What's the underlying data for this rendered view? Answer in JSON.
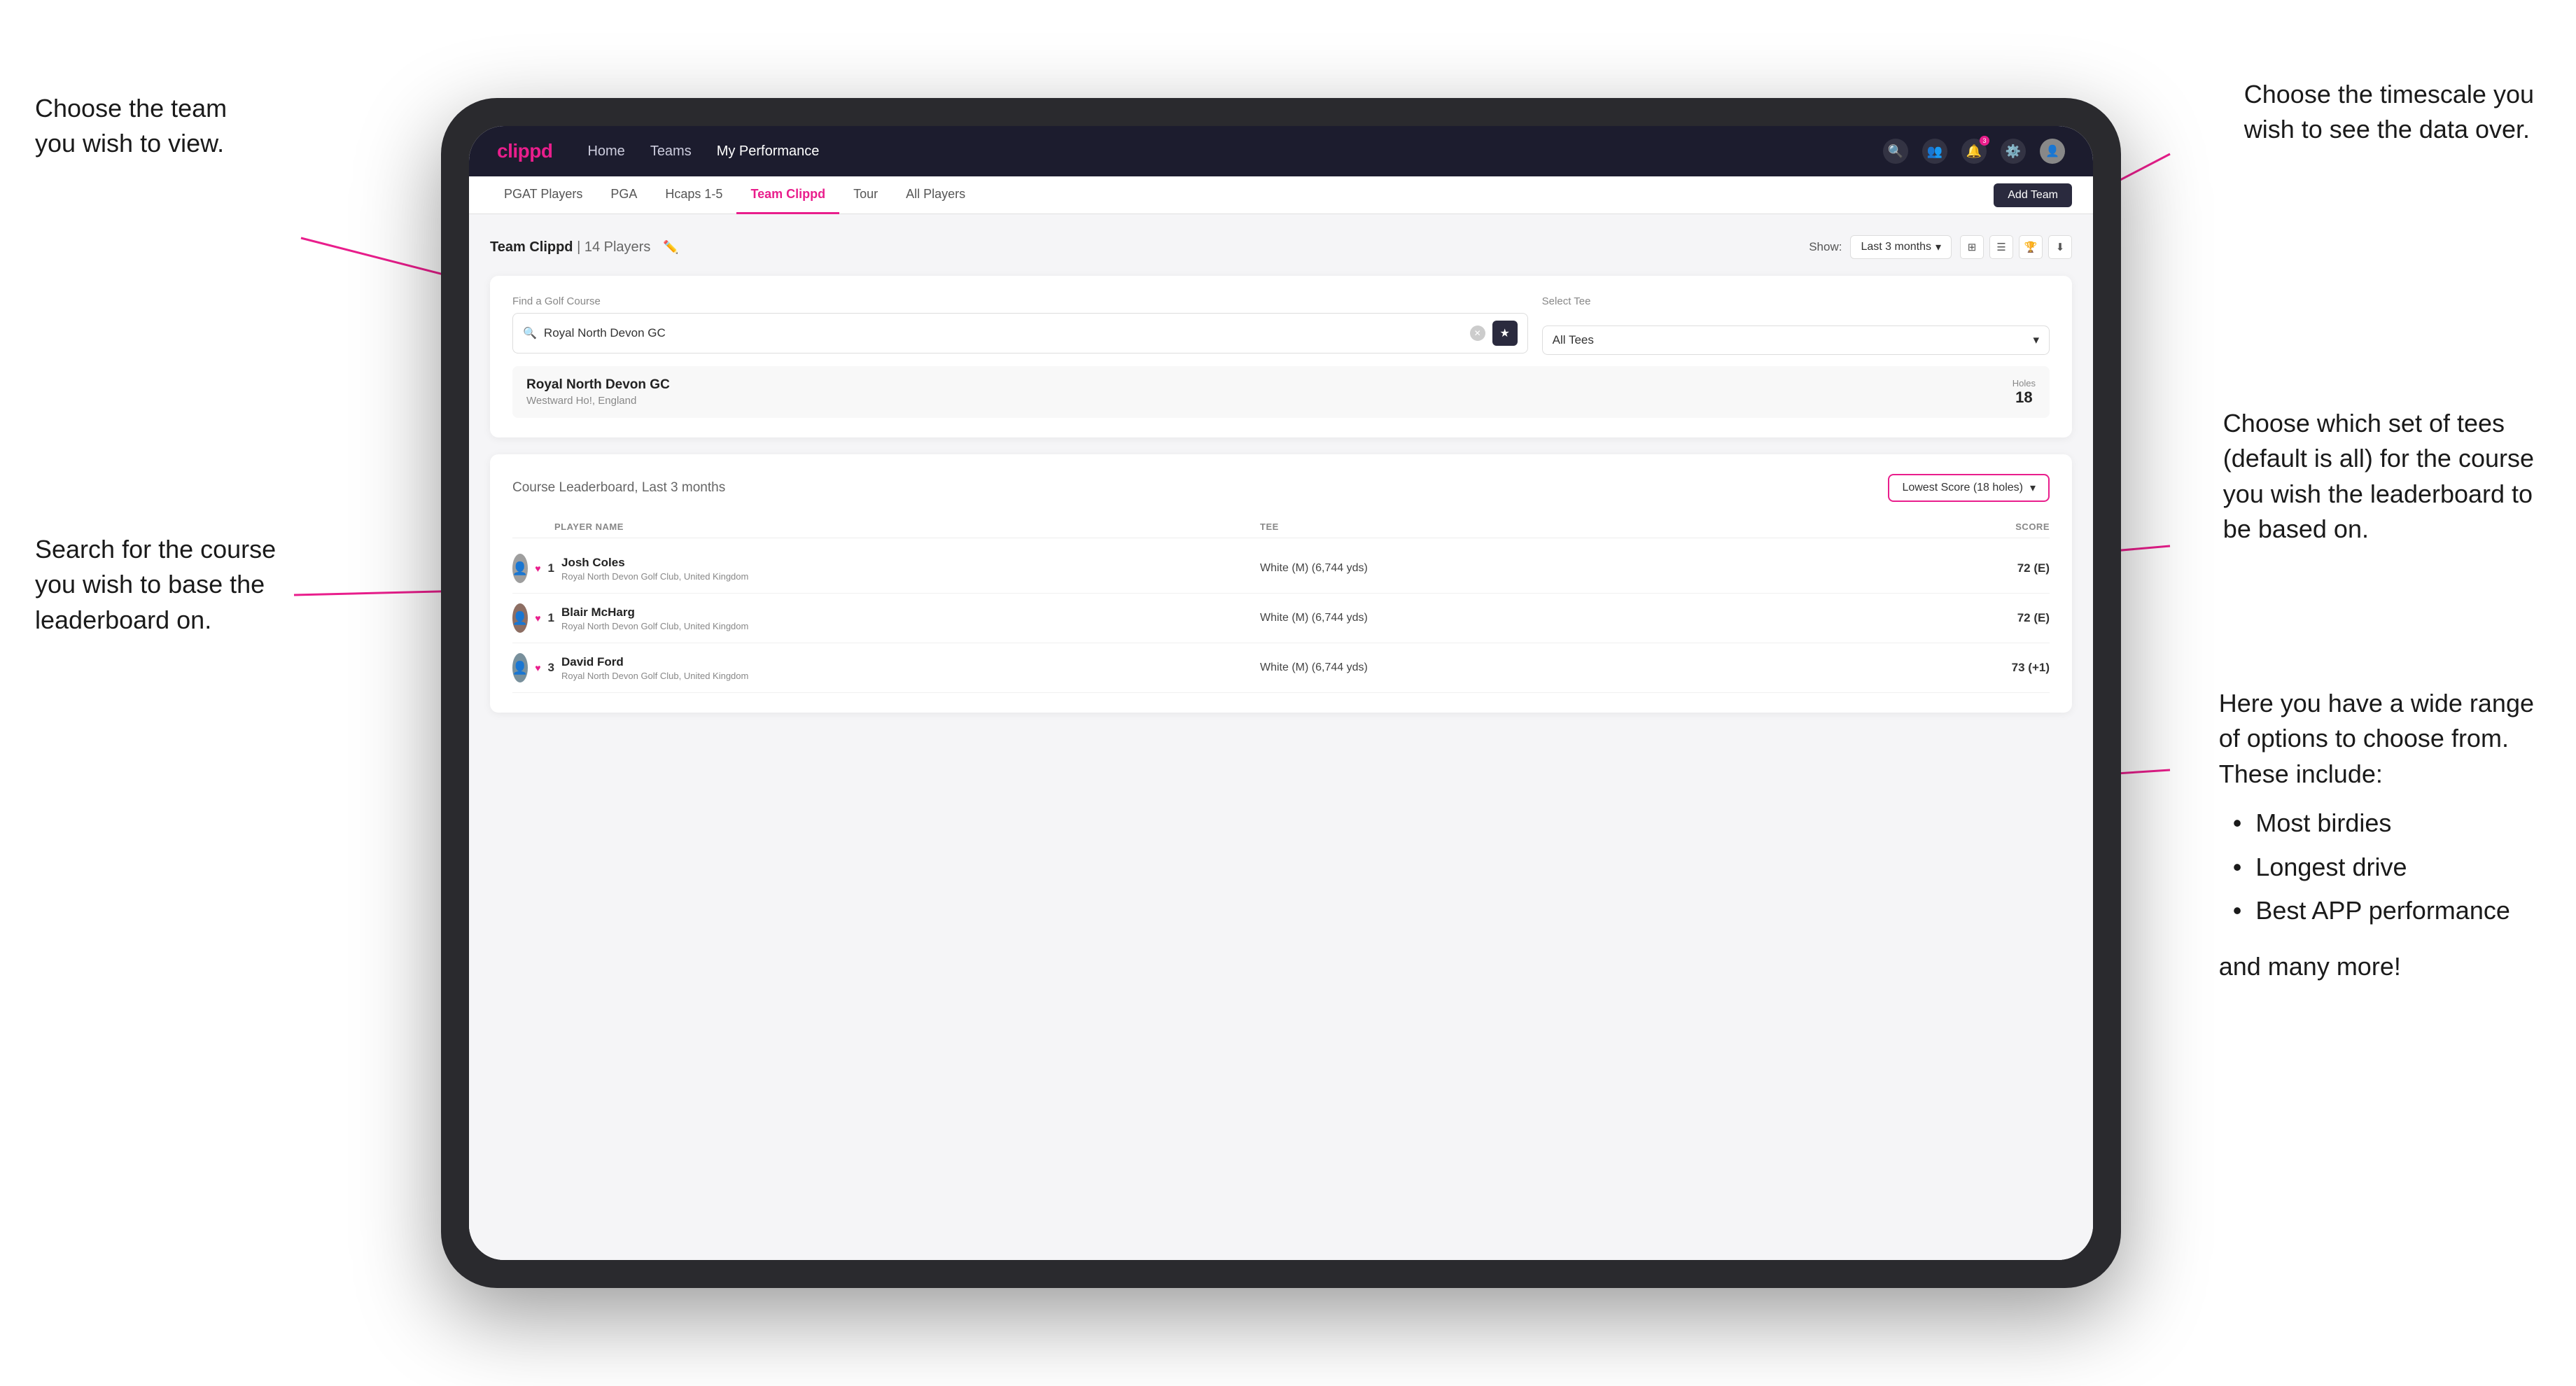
{
  "annotations": {
    "top_left_title": "Choose the team you\nwish to view.",
    "top_right_title": "Choose the timescale you\nwish to see the data over.",
    "middle_left_title": "Search for the course\nyou wish to base the\nleaderboard on.",
    "middle_right_title": "Choose which set of tees\n(default is all) for the course\nyou wish the leaderboard to\nbe based on.",
    "bottom_right_title": "Here you have a wide range\nof options to choose from.\nThese include:",
    "bullets": [
      "Most birdies",
      "Longest drive",
      "Best APP performance"
    ],
    "bottom_right_footer": "and many more!"
  },
  "nav": {
    "logo": "clippd",
    "links": [
      "Home",
      "Teams",
      "My Performance"
    ],
    "icons": [
      "search",
      "people",
      "bell",
      "settings",
      "user"
    ]
  },
  "subnav": {
    "items": [
      "PGAT Players",
      "PGA",
      "Hcaps 1-5",
      "Team Clippd",
      "Tour",
      "All Players"
    ],
    "active": "Team Clippd",
    "add_button": "Add Team"
  },
  "team_header": {
    "title": "Team Clippd",
    "player_count": "14 Players",
    "show_label": "Show:",
    "show_value": "Last 3 months"
  },
  "search": {
    "find_label": "Find a Golf Course",
    "placeholder": "Royal North Devon GC",
    "tee_label": "Select Tee",
    "tee_value": "All Tees"
  },
  "course": {
    "name": "Royal North Devon GC",
    "location": "Westward Ho!, England",
    "holes_label": "Holes",
    "holes_value": "18"
  },
  "leaderboard": {
    "title": "Course Leaderboard,",
    "subtitle": "Last 3 months",
    "score_option": "Lowest Score (18 holes)",
    "columns": [
      "PLAYER NAME",
      "TEE",
      "SCORE"
    ],
    "players": [
      {
        "rank": 1,
        "name": "Josh Coles",
        "club": "Royal North Devon Golf Club, United Kingdom",
        "tee": "White (M) (6,744 yds)",
        "score": "72 (E)"
      },
      {
        "rank": 1,
        "name": "Blair McHarg",
        "club": "Royal North Devon Golf Club, United Kingdom",
        "tee": "White (M) (6,744 yds)",
        "score": "72 (E)"
      },
      {
        "rank": 3,
        "name": "David Ford",
        "club": "Royal North Devon Golf Club, United Kingdom",
        "tee": "White (M) (6,744 yds)",
        "score": "73 (+1)"
      }
    ]
  },
  "colors": {
    "brand_pink": "#e91e8c",
    "nav_bg": "#1c1c2e",
    "active_tab": "#e91e8c"
  }
}
